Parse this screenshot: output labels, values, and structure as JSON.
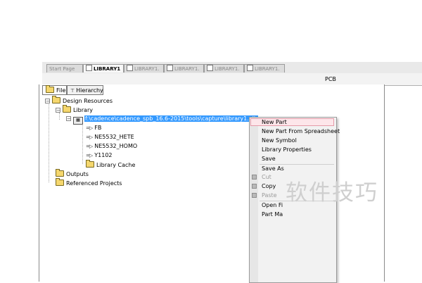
{
  "tabs": [
    {
      "label": "Start Page",
      "active": false
    },
    {
      "label": "LIBRARY1",
      "active": true
    },
    {
      "label": "LIBRARY1.",
      "active": false
    },
    {
      "label": "LIBRARY1.",
      "active": false
    },
    {
      "label": "LIBRARY1.",
      "active": false
    },
    {
      "label": "LIBRARY1.",
      "active": false
    }
  ],
  "pcb_label": "PCB",
  "panel_tabs": {
    "file": "File",
    "hierarchy": "Hierarchy"
  },
  "tree": {
    "design_resources": "Design Resources",
    "library": "Library",
    "library_path": "f:\\cadence\\cadence_spb_16.6-2015\\tools\\capture\\library1.olb",
    "parts": [
      "FB",
      "NE5532_HETE",
      "NE5532_HOMO",
      "Y1102"
    ],
    "library_cache": "Library Cache",
    "outputs": "Outputs",
    "referenced_projects": "Referenced Projects"
  },
  "context_menu": {
    "new_part": "New Part",
    "new_part_spreadsheet": "New Part From Spreadsheet",
    "new_symbol": "New Symbol",
    "library_properties": "Library Properties",
    "save": "Save",
    "save_as": "Save As",
    "cut": "Cut",
    "copy": "Copy",
    "paste": "Paste",
    "open_fi": "Open Fi",
    "part_ma": "Part Ma"
  },
  "watermark": "软件技巧",
  "colors": {
    "selection": "#3399ff",
    "menu_highlight": "#fde6ea",
    "folder": "#f5d76e"
  }
}
